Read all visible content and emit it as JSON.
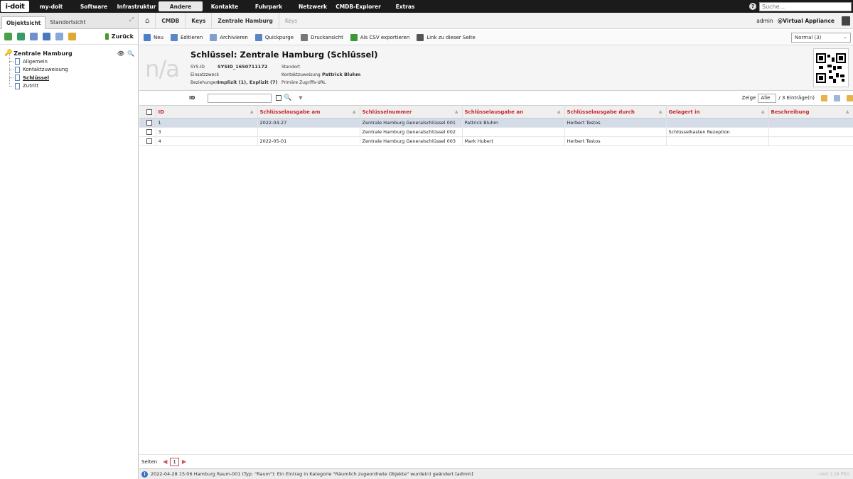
{
  "topbar": {
    "logo": "i-doit",
    "nav": [
      {
        "label": "my-doit",
        "width": 62,
        "active": false
      },
      {
        "label": "Software",
        "width": 58,
        "active": false
      },
      {
        "label": "Infrastruktur",
        "width": 62,
        "active": false
      },
      {
        "label": "Andere",
        "width": 62,
        "active": true
      },
      {
        "label": "Kontakte",
        "width": 62,
        "active": false
      },
      {
        "label": "Fuhrpark",
        "width": 62,
        "active": false
      },
      {
        "label": "Netzwerk",
        "width": 62,
        "active": false
      },
      {
        "label": "CMDB-Explorer",
        "width": 66,
        "active": false
      },
      {
        "label": "Extras",
        "width": 66,
        "active": false
      }
    ],
    "search_placeholder": "Suche..."
  },
  "left": {
    "tabs": [
      "Objektsicht",
      "Standortsicht"
    ],
    "back_label": "Zurück",
    "tree_root": "Zentrale Hamburg",
    "tree_children": [
      "Allgemein",
      "Kontaktzuweisung",
      "Schlüssel",
      "Zutritt"
    ]
  },
  "breadcrumb": [
    "CMDB",
    "Keys",
    "Zentrale Hamburg",
    "Keys"
  ],
  "user": {
    "name": "admin",
    "tenant": "@Virtual Appliance"
  },
  "toolbar": {
    "buttons": [
      {
        "label": "Neu",
        "color": "#4a7fcf"
      },
      {
        "label": "Editieren",
        "color": "#5b86c6"
      },
      {
        "label": "Archivieren",
        "color": "#7f9fcf"
      },
      {
        "label": "Quickpurge",
        "color": "#5b86c6"
      },
      {
        "label": "Druckansicht",
        "color": "#777777"
      },
      {
        "label": "Als CSV exportieren",
        "color": "#3a9a3a"
      },
      {
        "label": "Link zu dieser Seite",
        "color": "#555555"
      }
    ],
    "view_select": "Normal (3)"
  },
  "object": {
    "placeholder_image": "n/a",
    "title": "Schlüssel: Zentrale Hamburg (Schlüssel)",
    "sysid_label": "SYS-ID",
    "sysid_value": "SYSID_1650711172",
    "einsatz_label": "Einsatzzweck",
    "beziehungen_label": "Beziehungen",
    "beziehungen_value": "Implizit (1), Explizit (7)",
    "standort_label": "Standort",
    "kontakt_label": "Kontaktzuweisung",
    "kontakt_value": "Pattrick Bluhm",
    "url_label": "Primäre Zugriffs-URL",
    "url_value": "-"
  },
  "filter": {
    "label": "ID",
    "show_label": "Zeige",
    "show_value": "Alle",
    "count_text": "/ 3 Einträge(n)"
  },
  "table": {
    "columns": [
      "ID",
      "Schlüsselausgabe am",
      "Schlüsselnummer",
      "Schlüsselausgabe an",
      "Schlüsselausgabe durch",
      "Gelagert in",
      "Beschreibung"
    ],
    "rows": [
      {
        "id": "1",
        "date": "2022-04-27",
        "number": "Zentrale Hamburg Generalschlüssel 001",
        "to": "Pattrick Bluhm",
        "by": "Herbert Testos",
        "stored": "",
        "desc": "",
        "selected": true
      },
      {
        "id": "3",
        "date": "",
        "number": "Zentrale Hamburg Generalschlüssel 002",
        "to": "",
        "by": "",
        "stored": "Schlüsselkasten Rezeption",
        "desc": "",
        "selected": false
      },
      {
        "id": "4",
        "date": "2022-05-01",
        "number": "Zentrale Hamburg Generalschlüssel 003",
        "to": "Mark Hubert",
        "by": "Herbert Testos",
        "stored": "",
        "desc": "",
        "selected": false
      }
    ]
  },
  "pages": {
    "label": "Seiten",
    "current": "1"
  },
  "status": {
    "message": "2022-04-28 15:06 Hamburg Raum-001 (Typ: \"Raum\"): Ein Eintrag in Kategorie \"Räumlich zugeordnete Objekte\" wurde(n) geändert [admin]",
    "version": "i-doit 1.18 PRO"
  }
}
